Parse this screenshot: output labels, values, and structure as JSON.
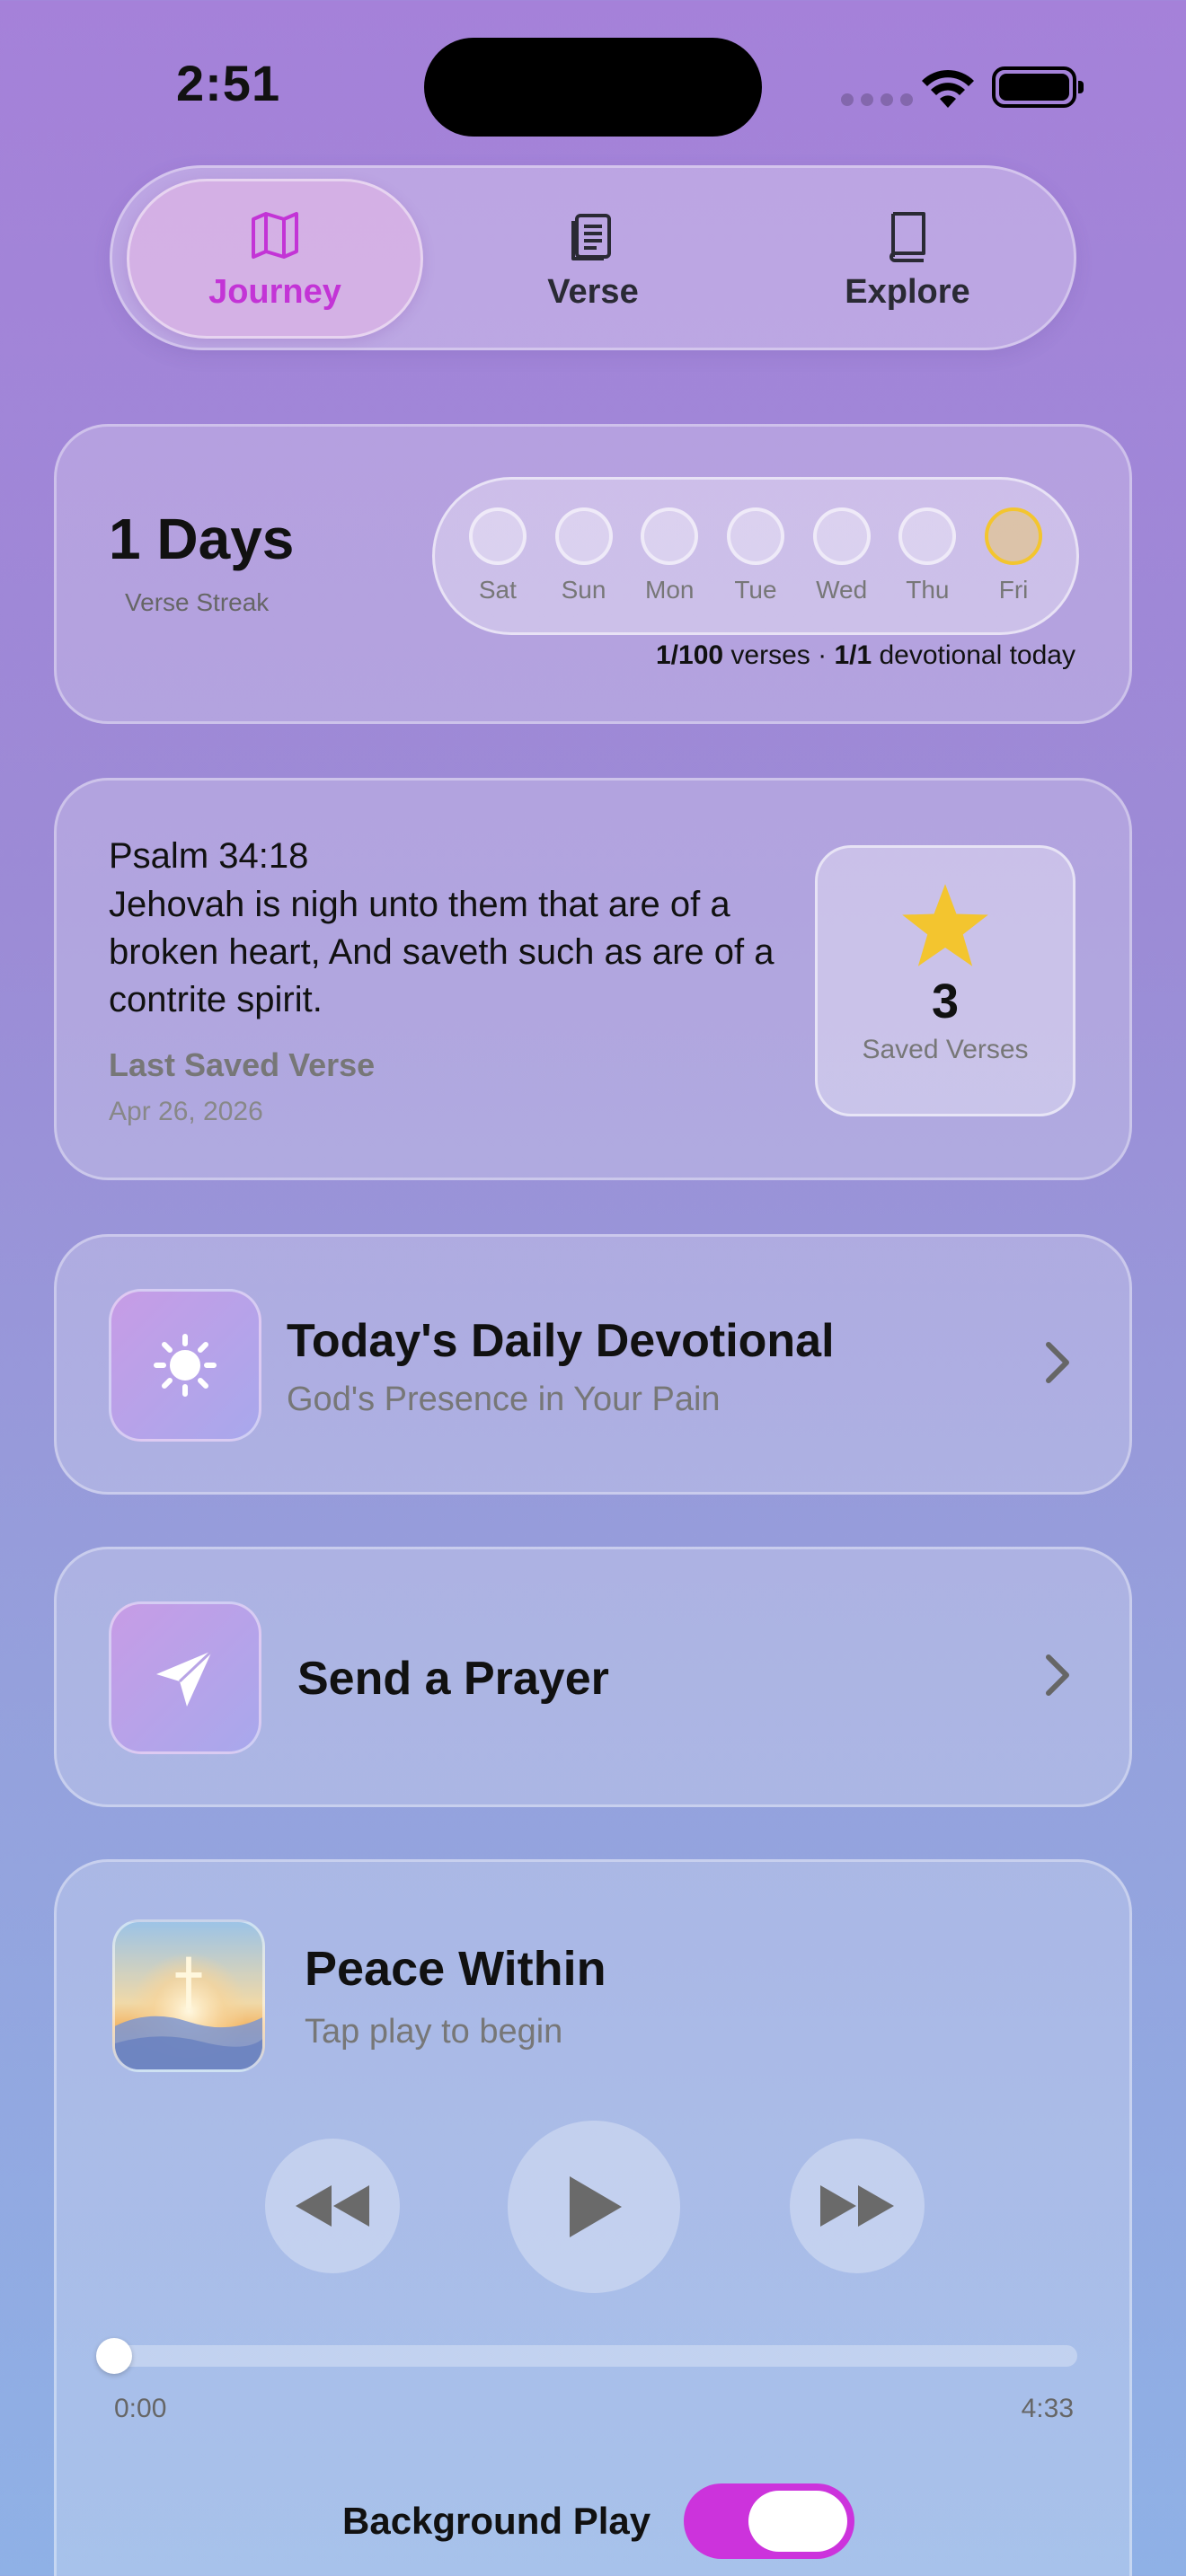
{
  "status_bar": {
    "time": "2:51"
  },
  "tabs": [
    {
      "label": "Journey",
      "icon": "map-icon",
      "active": true
    },
    {
      "label": "Verse",
      "icon": "document-icon",
      "active": false
    },
    {
      "label": "Explore",
      "icon": "book-icon",
      "active": false
    }
  ],
  "streak": {
    "count": "1 Days",
    "label": "Verse Streak",
    "days": [
      {
        "name": "Sat",
        "done": false
      },
      {
        "name": "Sun",
        "done": false
      },
      {
        "name": "Mon",
        "done": false
      },
      {
        "name": "Tue",
        "done": false
      },
      {
        "name": "Wed",
        "done": false
      },
      {
        "name": "Thu",
        "done": false
      },
      {
        "name": "Fri",
        "done": true
      }
    ],
    "verses_progress": "1/100",
    "verses_word": " verses · ",
    "devotional_progress": "1/1",
    "devotional_word": " devotional today"
  },
  "verse_card": {
    "reference": "Psalm 34:18",
    "text": "Jehovah is nigh unto them that are of a broken heart, And saveth such as are of a contrite spirit.",
    "saved_label": "Last Saved Verse",
    "date": "Apr 26, 2026",
    "saved_count": "3",
    "saved_count_label": "Saved Verses",
    "star_color": "#f3c52f"
  },
  "devotional": {
    "title": "Today's Daily Devotional",
    "subtitle": "God's Presence in Your Pain",
    "icon": "sun-icon"
  },
  "prayer": {
    "title": "Send a Prayer",
    "icon": "paper-plane-icon"
  },
  "player": {
    "title": "Peace Within",
    "subtitle": "Tap play to begin",
    "current_time": "0:00",
    "duration": "4:33",
    "progress": 0.0,
    "background_play_label": "Background Play",
    "background_play_on": true,
    "accent": "#cc33dc"
  }
}
